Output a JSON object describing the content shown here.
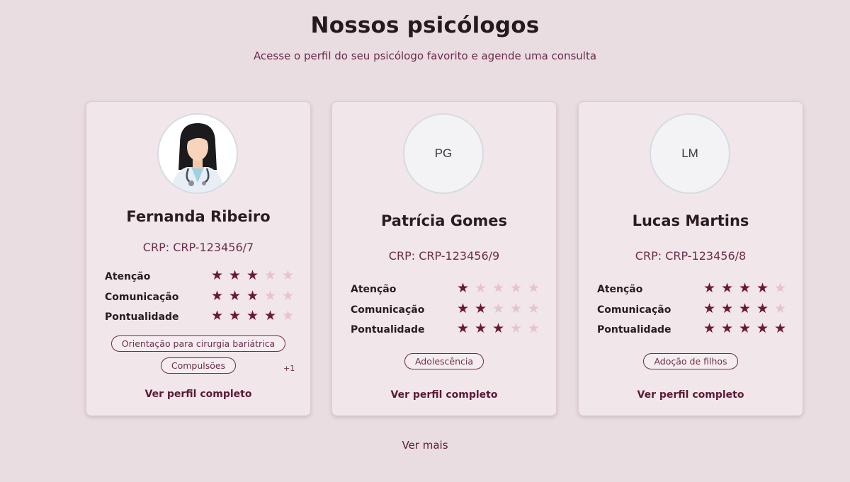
{
  "header": {
    "title": "Nossos psicólogos",
    "subtitle": "Acesse o perfil do seu psicólogo favorito e agende uma consulta"
  },
  "psychologists": [
    {
      "name": "Fernanda Ribeiro",
      "avatar_initials": "",
      "avatar_icon": "doctor-woman-illustration",
      "crp": "CRP: CRP-123456/7",
      "ratings": [
        {
          "label": "Atenção",
          "value": 3
        },
        {
          "label": "Comunicação",
          "value": 3
        },
        {
          "label": "Pontualidade",
          "value": 4
        }
      ],
      "tags": [
        "Orientação para cirurgia bariátrica",
        "Compulsões"
      ],
      "more_tags": "+1",
      "profile_link": "Ver perfil completo"
    },
    {
      "name": "Patrícia Gomes",
      "avatar_initials": "PG",
      "crp": "CRP: CRP-123456/9",
      "ratings": [
        {
          "label": "Atenção",
          "value": 1
        },
        {
          "label": "Comunicação",
          "value": 2
        },
        {
          "label": "Pontualidade",
          "value": 3
        }
      ],
      "tags": [
        "Adolescência"
      ],
      "profile_link": "Ver perfil completo"
    },
    {
      "name": "Lucas Martins",
      "avatar_initials": "LM",
      "crp": "CRP: CRP-123456/8",
      "ratings": [
        {
          "label": "Atenção",
          "value": 4
        },
        {
          "label": "Comunicação",
          "value": 4
        },
        {
          "label": "Pontualidade",
          "value": 5
        }
      ],
      "tags": [
        "Adoção de filhos"
      ],
      "profile_link": "Ver perfil completo"
    }
  ],
  "rating_max": 5,
  "colors": {
    "star_on": "#6b1738",
    "star_off": "#e6c3d1",
    "accent": "#6b2e4b"
  },
  "footer": {
    "see_more": "Ver mais"
  }
}
